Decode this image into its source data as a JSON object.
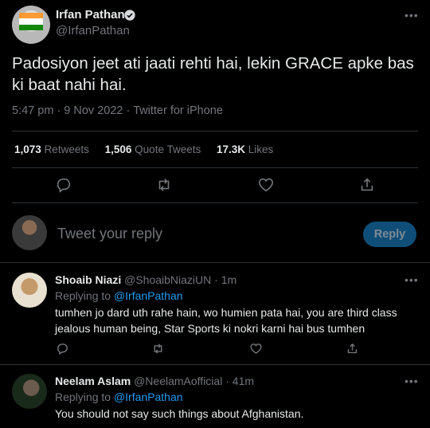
{
  "tweet": {
    "author_name": "Irfan Pathan",
    "author_handle": "@IrfanPathan",
    "text": "Padosiyon jeet ati jaati rehti hai, lekin GRACE apke bas ki baat nahi hai.",
    "time": "5:47 pm",
    "date": "9 Nov 2022",
    "source": "Twitter for iPhone",
    "stats": {
      "retweets_count": "1,073",
      "retweets_label": "Retweets",
      "quotes_count": "1,506",
      "quotes_label": "Quote Tweets",
      "likes_count": "17.3K",
      "likes_label": "Likes"
    }
  },
  "compose": {
    "placeholder": "Tweet your reply",
    "button_label": "Reply"
  },
  "replies": [
    {
      "name": "Shoaib Niazi",
      "handle": "@ShoaibNiaziUN",
      "time": "1m",
      "replying_prefix": "Replying to",
      "replying_to": "@IrfanPathan",
      "text": "tumhen jo dard uth rahe hain, wo humien pata hai, you are third class jealous human being, Star Sports ki nokri karni hai bus tumhen"
    },
    {
      "name": "Neelam Aslam",
      "handle": "@NeelamAofficial",
      "time": "41m",
      "replying_prefix": "Replying to",
      "replying_to": "@IrfanPathan",
      "text": "You should not say such things about Afghanistan."
    }
  ],
  "colors": {
    "accent": "#1d9bf0",
    "muted": "#71767b",
    "text": "#e7e9ea",
    "divider": "#2f3336",
    "background": "#000000"
  }
}
